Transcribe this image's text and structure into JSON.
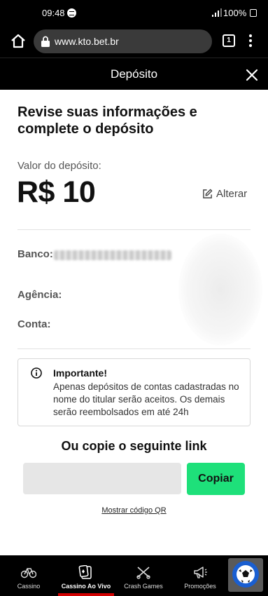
{
  "status_bar": {
    "time": "09:48",
    "battery": "100%"
  },
  "browser": {
    "url": "www.kto.bet.br",
    "tab_count": "1"
  },
  "modal": {
    "title": "Depósito"
  },
  "content": {
    "heading": "Revise suas informações e complete o depósito",
    "amount_label": "Valor do depósito:",
    "amount_value": "R$ 10",
    "edit_label": "Alterar",
    "bank_label": "Banco:",
    "agency_label": "Agência:",
    "account_label": "Conta:",
    "notice_title": "Importante!",
    "notice_text": "Apenas depósitos de contas cadastradas no nome do titular serão aceitos. Os demais serão reembolsados em até 24h",
    "copy_heading": "Ou copie o seguinte link",
    "copy_button": "Copiar",
    "qr_link": "Mostrar código QR"
  },
  "bottom_nav": {
    "items": [
      {
        "label": "Cassino",
        "icon": "bike-icon"
      },
      {
        "label": "Cassino Ao Vivo",
        "icon": "cards-icon"
      },
      {
        "label": "Crash Games",
        "icon": "crossed-icon"
      },
      {
        "label": "Promoções",
        "icon": "megaphone-icon"
      }
    ],
    "active_index": 1,
    "active_color": "#d00000"
  },
  "colors": {
    "accent": "#1ee07a",
    "header_bg": "#000000"
  }
}
